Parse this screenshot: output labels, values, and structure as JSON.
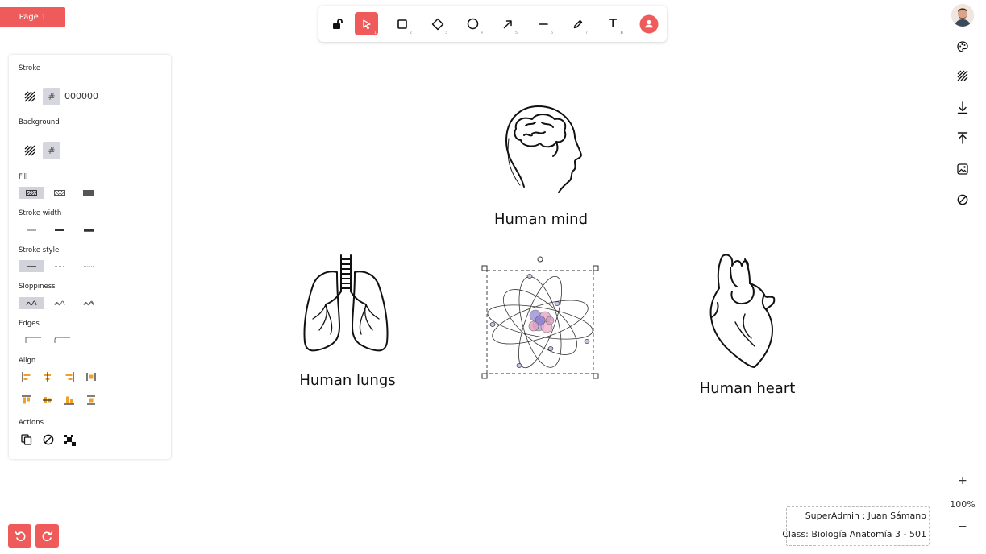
{
  "page": {
    "label": "Page 1"
  },
  "toolbar": {
    "tools": [
      {
        "name": "lock-tool",
        "shortcut": ""
      },
      {
        "name": "select-tool",
        "shortcut": "1"
      },
      {
        "name": "rectangle-tool",
        "shortcut": "2"
      },
      {
        "name": "diamond-tool",
        "shortcut": "3"
      },
      {
        "name": "ellipse-tool",
        "shortcut": "4"
      },
      {
        "name": "arrow-tool",
        "shortcut": "5"
      },
      {
        "name": "line-tool",
        "shortcut": "6"
      },
      {
        "name": "draw-tool",
        "shortcut": "7"
      },
      {
        "name": "text-tool",
        "shortcut": "8"
      },
      {
        "name": "collaboration-tool",
        "shortcut": ""
      }
    ],
    "text_tool_glyph": "T",
    "accent": "#ef5a5a"
  },
  "panel": {
    "stroke": {
      "label": "Stroke",
      "hash": "#",
      "value": "000000"
    },
    "background": {
      "label": "Background",
      "hash": "#"
    },
    "fill": {
      "label": "Fill"
    },
    "stroke_width": {
      "label": "Stroke width"
    },
    "stroke_style": {
      "label": "Stroke style"
    },
    "sloppiness": {
      "label": "Sloppiness"
    },
    "edges": {
      "label": "Edges"
    },
    "align": {
      "label": "Align"
    },
    "actions": {
      "label": "Actions"
    }
  },
  "canvas": {
    "labels": {
      "mind": "Human mind",
      "lungs": "Human lungs",
      "heart": "Human heart"
    }
  },
  "sidebar": {
    "zoom_in": "+",
    "zoom_level": "100%",
    "zoom_out": "−"
  },
  "footer": {
    "user": "SuperAdmin : Juan Sámano",
    "class_info": "Class: Biología Anatomía 3 - 501"
  }
}
